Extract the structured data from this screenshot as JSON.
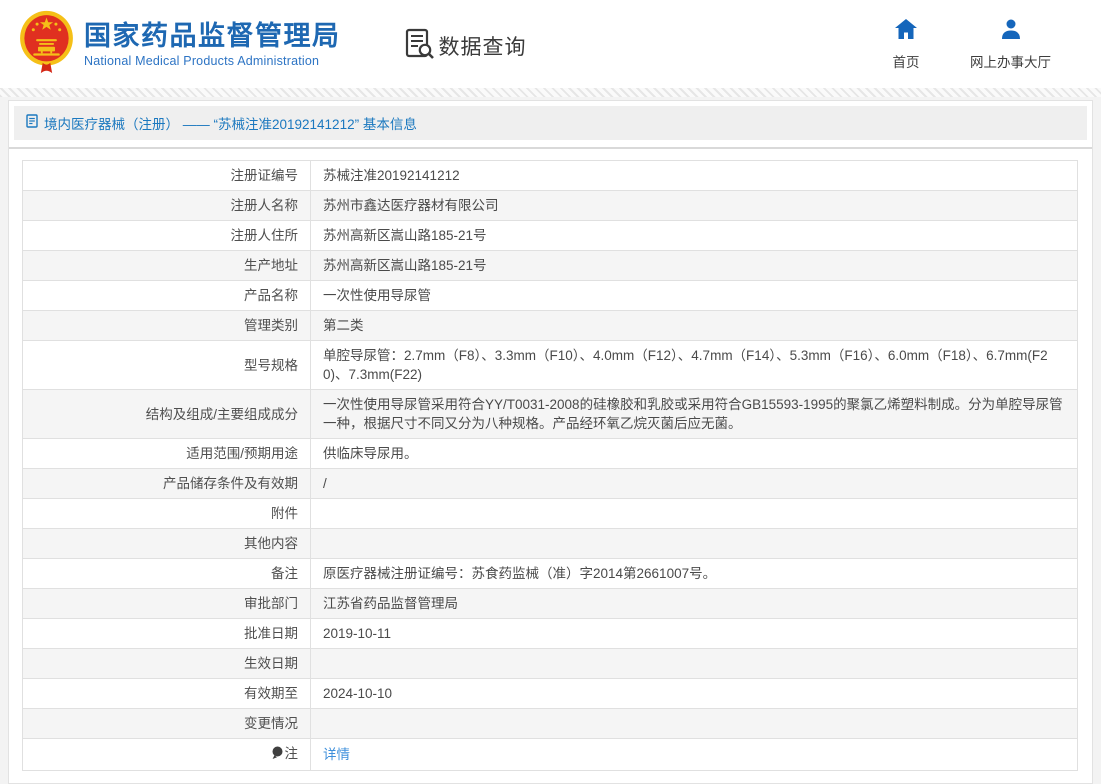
{
  "header": {
    "logo": {
      "title": "国家药品监督管理局",
      "subtitle": "National Medical Products Administration",
      "emblem_icon": "china-national-emblem-icon"
    },
    "section": {
      "label": "数据查询",
      "icon": "document-search-icon"
    },
    "nav": [
      {
        "label": "首页",
        "icon": "home-icon"
      },
      {
        "label": "网上办事大厅",
        "icon": "user-icon"
      }
    ]
  },
  "breadcrumb": {
    "icon": "document-icon",
    "text": "境内医疗器械（注册） —— “苏械注准20192141212” 基本信息"
  },
  "table": {
    "rows": [
      {
        "label": "注册证编号",
        "value": "苏械注准20192141212"
      },
      {
        "label": "注册人名称",
        "value": "苏州市鑫达医疗器材有限公司"
      },
      {
        "label": "注册人住所",
        "value": "苏州高新区嵩山路185-21号"
      },
      {
        "label": "生产地址",
        "value": "苏州高新区嵩山路185-21号"
      },
      {
        "label": "产品名称",
        "value": "一次性使用导尿管"
      },
      {
        "label": "管理类别",
        "value": "第二类"
      },
      {
        "label": "型号规格",
        "value": "单腔导尿管：2.7mm（F8）、3.3mm（F10）、4.0mm（F12）、4.7mm（F14）、5.3mm（F16）、6.0mm（F18）、6.7mm(F20)、7.3mm(F22)"
      },
      {
        "label": "结构及组成/主要组成成分",
        "value": "一次性使用导尿管采用符合YY/T0031-2008的硅橡胶和乳胶或采用符合GB15593-1995的聚氯乙烯塑料制成。分为单腔导尿管一种，根据尺寸不同又分为八种规格。产品经环氧乙烷灭菌后应无菌。"
      },
      {
        "label": "适用范围/预期用途",
        "value": "供临床导尿用。"
      },
      {
        "label": "产品储存条件及有效期",
        "value": "/"
      },
      {
        "label": "附件",
        "value": ""
      },
      {
        "label": "其他内容",
        "value": ""
      },
      {
        "label": "备注",
        "value": "原医疗器械注册证编号：苏食药监械（准）字2014第2661007号。"
      },
      {
        "label": "审批部门",
        "value": "江苏省药品监督管理局"
      },
      {
        "label": "批准日期",
        "value": "2019-10-11"
      },
      {
        "label": "生效日期",
        "value": ""
      },
      {
        "label": "有效期至",
        "value": "2024-10-10"
      },
      {
        "label": "变更情况",
        "value": ""
      },
      {
        "label": "注",
        "value_link": "详情",
        "icon": "note-icon"
      }
    ]
  },
  "colors": {
    "brand_blue": "#1e68b2",
    "breadcrumb_blue": "#1b78bf",
    "link_blue": "#3d8fdb",
    "nav_icon_blue": "#1566bb",
    "row_alt_bg": "#f5f5f5",
    "emblem_red": "#e03020",
    "emblem_gold": "#f5c018"
  }
}
